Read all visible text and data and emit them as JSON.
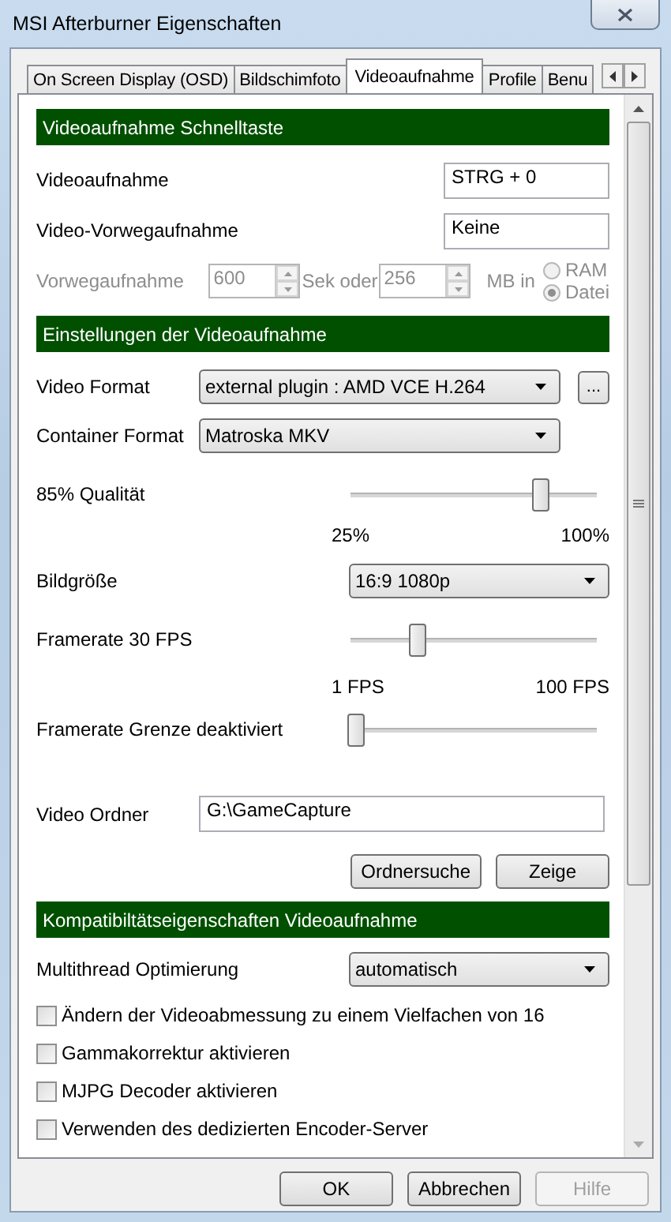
{
  "window": {
    "title": "MSI Afterburner Eigenschaften"
  },
  "tabs": [
    {
      "label": "On Screen Display (OSD)",
      "selected": false
    },
    {
      "label": "Bildschimfoto",
      "selected": false
    },
    {
      "label": "Videoaufnahme",
      "selected": true
    },
    {
      "label": "Profile",
      "selected": false
    },
    {
      "label": "Benu",
      "selected": false
    }
  ],
  "sections": [
    {
      "title": "Videoaufnahme Schnelltaste",
      "rows": [
        {
          "kind": "hotkey",
          "label": "Videoaufnahme",
          "value": "STRG + 0"
        },
        {
          "kind": "hotkey",
          "label": "Video-Vorwegaufnahme",
          "value": "Keine"
        },
        {
          "kind": "prerecord",
          "label": "Vorwegaufnahme",
          "disabled": true,
          "seconds": "600",
          "seconds_unit": "Sek oder",
          "megabytes": "256",
          "megabytes_unit": "MB in",
          "radios": [
            {
              "label": "RAM",
              "selected": false
            },
            {
              "label": "Datei",
              "selected": true
            }
          ]
        }
      ]
    },
    {
      "title": "Einstellungen der Videoaufnahme",
      "rows": [
        {
          "kind": "combo",
          "label": "Video Format",
          "value": "external plugin : AMD VCE H.264",
          "button": "..."
        },
        {
          "kind": "combo",
          "label": "Container Format",
          "value": "Matroska MKV"
        },
        {
          "kind": "slider",
          "label": "85% Qualität",
          "level": 0.78,
          "min_label": "25%",
          "max_label": "100%"
        },
        {
          "kind": "choice",
          "label": "Bildgröße",
          "value": "16:9 1080p"
        },
        {
          "kind": "slider",
          "label": "Framerate 30 FPS",
          "level": 0.26,
          "min_label": "1 FPS",
          "max_label": "100 FPS"
        },
        {
          "kind": "slider",
          "label": "Framerate Grenze deaktiviert",
          "level": 0
        },
        {
          "kind": "path",
          "label": "Video Ordner",
          "value": "G:\\GameCapture"
        },
        {
          "kind": "actions",
          "buttons": [
            "Ordnersuche",
            "Zeige"
          ]
        }
      ]
    },
    {
      "title": "Kompatibiltätseigenschaften Videoaufnahme",
      "rows": [
        {
          "kind": "choice",
          "label": "Multithread Optimierung",
          "value": "automatisch"
        },
        {
          "kind": "checkbox",
          "label": "Ändern der Videoabmessung zu einem Vielfachen von 16",
          "checked": false
        },
        {
          "kind": "checkbox",
          "label": "Gammakorrektur aktivieren",
          "checked": false
        },
        {
          "kind": "checkbox",
          "label": "MJPG Decoder aktivieren",
          "checked": false
        },
        {
          "kind": "checkbox",
          "label": "Verwenden des dedizierten Encoder-Server",
          "checked": false
        }
      ]
    }
  ],
  "buttons": [
    {
      "label": "OK",
      "disabled": false
    },
    {
      "label": "Abbrechen",
      "disabled": false
    },
    {
      "label": "Hilfe",
      "disabled": true
    }
  ]
}
